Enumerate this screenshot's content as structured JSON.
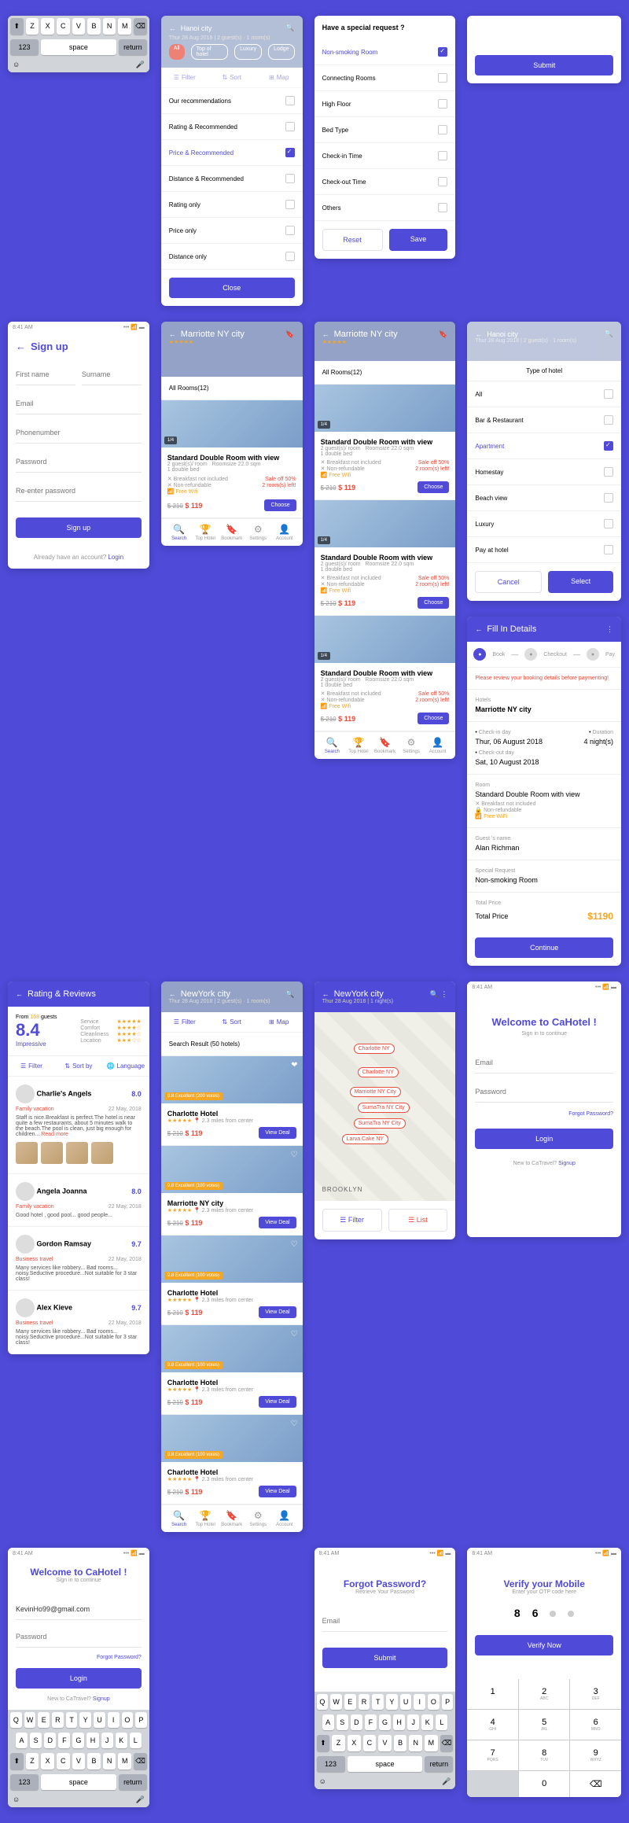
{
  "keyboard1": {
    "row1": [
      "Z",
      "X",
      "C",
      "V",
      "B",
      "N",
      "M"
    ],
    "bottom": [
      "123",
      "space",
      "return"
    ]
  },
  "signup": {
    "title": "Sign up",
    "firstname": "First name",
    "surname": "Surname",
    "email": "Email",
    "phone": "Phonenumber",
    "password": "Password",
    "reenter": "Re-enter password",
    "btn": "Sign up",
    "already": "Already have an account?",
    "login": "Login"
  },
  "hanoi": {
    "title": "Hanoi city",
    "subtitle": "Thur 28 Aug 2018 | 2 guest(s) · 1 room(s)",
    "filters": [
      "All",
      "Top of hotel",
      "Luxury",
      "Lodge"
    ],
    "tabs": [
      "Filter",
      "Sort",
      "Map"
    ],
    "sort_options": [
      "Our recommendations",
      "Rating & Recommended",
      "Price & Recommended",
      "Distance & Recommended",
      "Rating only",
      "Price only",
      "Distance only"
    ],
    "selected": 2,
    "close": "Close"
  },
  "special": {
    "title": "Have a special request ?",
    "options": [
      "Non-smoking Room",
      "Connecting Rooms",
      "High Floor",
      "Bed Type",
      "Check-in Time",
      "Check-out Time",
      "Others"
    ],
    "selected": 0,
    "reset": "Reset",
    "save": "Save"
  },
  "submit_only": {
    "btn": "Submit"
  },
  "hoteltype": {
    "title": "Type of hotel",
    "header_title": "Hanoi city",
    "header_sub": "Thur 28 Aug 2018 | 2 guest(s) · 1 room(s)",
    "options": [
      "All",
      "Bar & Restaurant",
      "Apartment",
      "Homestay",
      "Beach view",
      "Luxury",
      "Pay at hotel"
    ],
    "selected": 2,
    "cancel": "Cancel",
    "select": "Select"
  },
  "marriotte": {
    "title": "Marriotte NY city",
    "allrooms": "All Rooms(12)",
    "room": {
      "name": "Standard Double Room with view",
      "guests": "2 guest(s)/ room",
      "size": "Roomsize 22.0 sqm",
      "bed": "1 double bed",
      "breakfast": "Breakfast not included",
      "nonref": "Non-refundable",
      "wifi": "Free Wifi",
      "saleoff": "Sale off 50%",
      "roomsleft": "2 room(s) left!",
      "old_price": "$ 210",
      "price": "$ 119",
      "choose": "Choose"
    },
    "nav": [
      "Search",
      "Top Hotel",
      "Bookmark",
      "Settings",
      "Account"
    ]
  },
  "newyork": {
    "title": "NewYork city",
    "subtitle": "Thur 28 Aug 2018 | 2 guest(s) · 1 room(s)",
    "tabs": [
      "Filter",
      "Sort",
      "Map"
    ],
    "result": "Search Result (50 hotels)",
    "hotels": [
      {
        "name": "Charlotte Hotel",
        "rating": "9.8 Excellent (200 votes)",
        "dist": "2.3 miles from center",
        "old": "$ 210",
        "price": "$ 119",
        "deal": "View Deal"
      },
      {
        "name": "Marriotte NY city",
        "rating": "9.8 Excellent (100 votes)",
        "dist": "2.3 miles from center",
        "old": "$ 210",
        "price": "$ 119",
        "deal": "View Deal"
      },
      {
        "name": "Charlotte Hotel",
        "rating": "9.8 Excellent (100 votes)",
        "dist": "2.3 miles from center",
        "old": "$ 210",
        "price": "$ 119",
        "deal": "View Deal"
      },
      {
        "name": "Charlotte Hotel",
        "rating": "9.8 Excellent (100 votes)",
        "dist": "2.3 miles from center",
        "old": "$ 210",
        "price": "$ 119",
        "deal": "View Deal"
      },
      {
        "name": "Charlotte Hotel",
        "rating": "9.8 Excellent (100 votes)",
        "dist": "2.3 miles from center",
        "old": "$ 210",
        "price": "$ 119",
        "deal": "View Deal"
      }
    ]
  },
  "reviews": {
    "title": "Rating & Reviews",
    "from": "From",
    "count": "168",
    "guests": "guests",
    "score": "8.4",
    "impressive": "Impressive",
    "cats": [
      {
        "n": "Service",
        "s": 5
      },
      {
        "n": "Comfort",
        "s": 4
      },
      {
        "n": "Cleanliness",
        "s": 4
      },
      {
        "n": "Location",
        "s": 3
      }
    ],
    "tabs": [
      "Filter",
      "Sort by",
      "Language"
    ],
    "items": [
      {
        "name": "Charlie's Angels",
        "score": "8.0",
        "tag": "Family vacation",
        "date": "22 May, 2018",
        "text": "Staff is nice.Breakfast is perfect.The hotel is near quite a few restaurants, about 5 minutes walk to the beach.The pool is clean, just big enough for children...",
        "more": "Read more"
      },
      {
        "name": "Angela Joanna",
        "score": "8.0",
        "tag": "Family vacation",
        "date": "22 May, 2018",
        "text": "Good hotel , good pool... good people..."
      },
      {
        "name": "Gordon Ramsay",
        "score": "9.7",
        "tag": "Business travel",
        "date": "22 May, 2018",
        "text": "Many services like robbery... Bad rooms... noisy.Seductive procedure...Not suitable for 3 star class!"
      },
      {
        "name": "Alex Kieve",
        "score": "9.7",
        "tag": "Business travel",
        "date": "22 May, 2018",
        "text": "Many services like robbery... Bad rooms... noisy.Seductive procedure...Not suitable for 3 star class!"
      }
    ]
  },
  "welcome": {
    "title": "Welcome to CaHotel !",
    "sub": "Sign in to continue",
    "email_val": "KevinHo99@gmail.com",
    "password": "Password",
    "forgot": "Forgot Password?",
    "login": "Login",
    "new": "New to CaTravel?",
    "signup": "Signup"
  },
  "welcome2": {
    "title": "Welcome to CaHotel !",
    "sub": "Sign in to continue",
    "email": "Email",
    "password": "Password",
    "forgot": "Forgot Password?",
    "login": "Login",
    "new": "New to CaTravel?",
    "signup": "Signup"
  },
  "nymap": {
    "title": "NewYork city",
    "sub": "Thur 28 Aug 2018 | 1 night(s)",
    "pins": [
      "Charlotte NY",
      "Charlotte NY",
      "Marriotte NY City",
      "SumaTra NY City",
      "SumaTra NY City",
      "Larva Cake NY"
    ],
    "filter": "Filter",
    "list": "List"
  },
  "details": {
    "title": "Fill In Details",
    "steps": [
      "Book",
      "Checkout",
      "Pay"
    ],
    "warning": "Please review your booking details before paymenting!",
    "hotels": "Hotels",
    "hotel": "Marriotte NY city",
    "checkin_l": "Check-in day",
    "checkin": "Thur, 06 August 2018",
    "duration_l": "Duration",
    "duration": "4 night(s)",
    "checkout_l": "Check-out day",
    "checkout": "Sat, 10 August 2018",
    "room_l": "Room",
    "room": "Standard Double Room with view",
    "breakfast": "Breakfast not included",
    "nonref": "Non-refundable",
    "wifi": "Free WiFi",
    "guest_l": "Guest 's name",
    "guest": "Alan Richman",
    "special_l": "Special Request",
    "special": "Non-smoking Room",
    "total_l": "Total Price",
    "total_label": "Total Price",
    "total": "$1190",
    "continue": "Continue"
  },
  "forgot": {
    "title": "Forgot Password?",
    "sub": "Retrieve Your Password",
    "email": "Email",
    "submit": "Submit"
  },
  "verify": {
    "title": "Verify your Mobile",
    "sub": "Enter your OTP code here",
    "code": [
      "8",
      "6",
      "",
      ""
    ],
    "btn": "Verify Now"
  },
  "keyboard_full": {
    "r1": [
      "Q",
      "W",
      "E",
      "R",
      "T",
      "Y",
      "U",
      "I",
      "O",
      "P"
    ],
    "r2": [
      "A",
      "S",
      "D",
      "F",
      "G",
      "H",
      "J",
      "K",
      "L"
    ],
    "r3": [
      "Z",
      "X",
      "C",
      "V",
      "B",
      "N",
      "M"
    ]
  },
  "numpad": {
    "keys": [
      [
        "1",
        ""
      ],
      [
        "2",
        "ABC"
      ],
      [
        "3",
        "DEF"
      ],
      [
        "4",
        "GHI"
      ],
      [
        "5",
        "JKL"
      ],
      [
        "6",
        "MNO"
      ],
      [
        "7",
        "PQRS"
      ],
      [
        "8",
        "TUV"
      ],
      [
        "9",
        "WXYZ"
      ],
      [
        "",
        ""
      ],
      [
        "0",
        ""
      ],
      [
        "⌫",
        ""
      ]
    ]
  },
  "time": "8:41 AM"
}
